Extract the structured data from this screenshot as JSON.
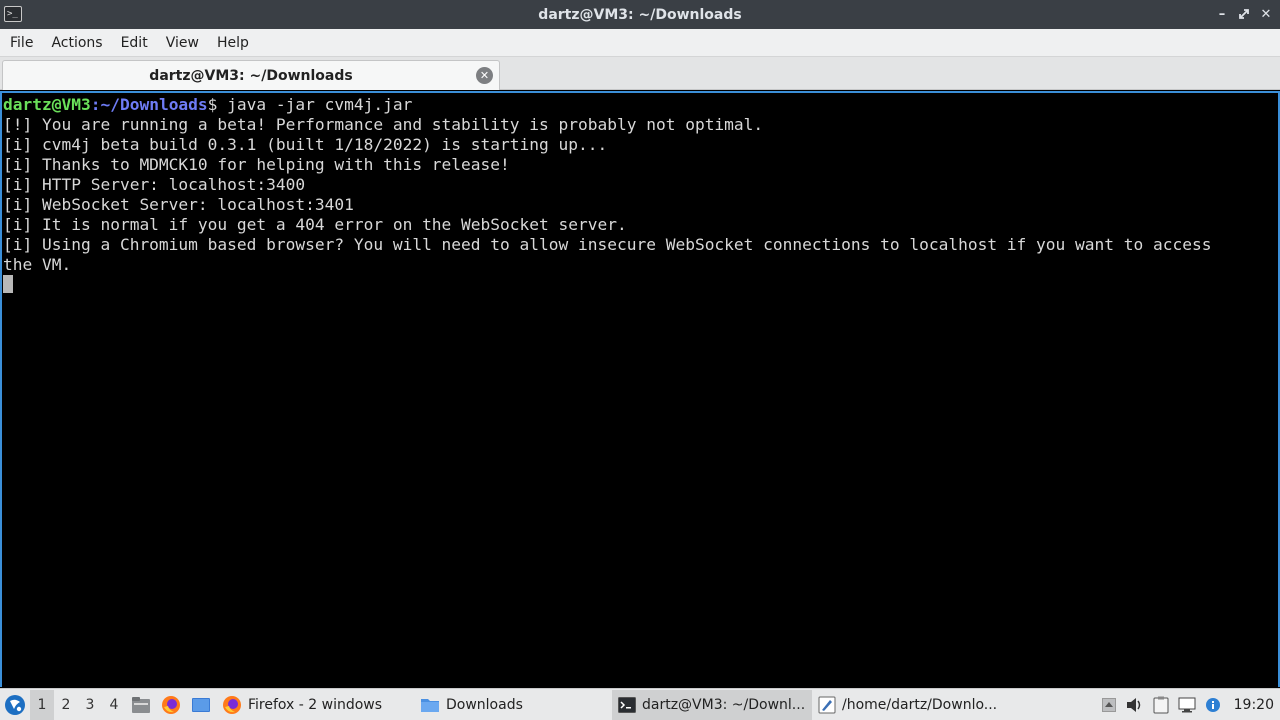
{
  "window": {
    "title": "dartz@VM3: ~/Downloads",
    "icon": "terminal-icon",
    "controls": [
      "minimize",
      "restore",
      "close"
    ]
  },
  "menubar": {
    "items": [
      "File",
      "Actions",
      "Edit",
      "View",
      "Help"
    ]
  },
  "tabs": [
    {
      "label": "dartz@VM3: ~/Downloads",
      "active": true
    }
  ],
  "terminal": {
    "prompt_user": "dartz@VM3",
    "prompt_sep": ":",
    "prompt_path": "~/Downloads",
    "prompt_symbol": "$",
    "command": " java -jar cvm4j.jar",
    "lines": [
      "[!] You are running a beta! Performance and stability is probably not optimal.",
      "[i] cvm4j beta build 0.3.1 (built 1/18/2022) is starting up...",
      "[i] Thanks to MDMCK10 for helping with this release!",
      "[i] HTTP Server: localhost:3400",
      "[i] WebSocket Server: localhost:3401",
      "[i] It is normal if you get a 404 error on the WebSocket server.",
      "[i] Using a Chromium based browser? You will need to allow insecure WebSocket connections to localhost if you want to access",
      "the VM."
    ],
    "colors": {
      "user": "#6ae05a",
      "path": "#6e7cf5",
      "text": "#d8d8d8",
      "border": "#3b8fd9"
    }
  },
  "taskbar": {
    "workspaces": [
      "1",
      "2",
      "3",
      "4"
    ],
    "active_workspace": "1",
    "tasks": [
      {
        "label": "Firefox - 2 windows",
        "icon": "firefox-icon"
      },
      {
        "label": "Downloads",
        "icon": "folder-icon"
      },
      {
        "label": "dartz@VM3: ~/Downl...",
        "icon": "terminal-icon",
        "active": true
      },
      {
        "label": "/home/dartz/Downlo...",
        "icon": "text-editor-icon"
      }
    ],
    "clock": "19:20"
  }
}
